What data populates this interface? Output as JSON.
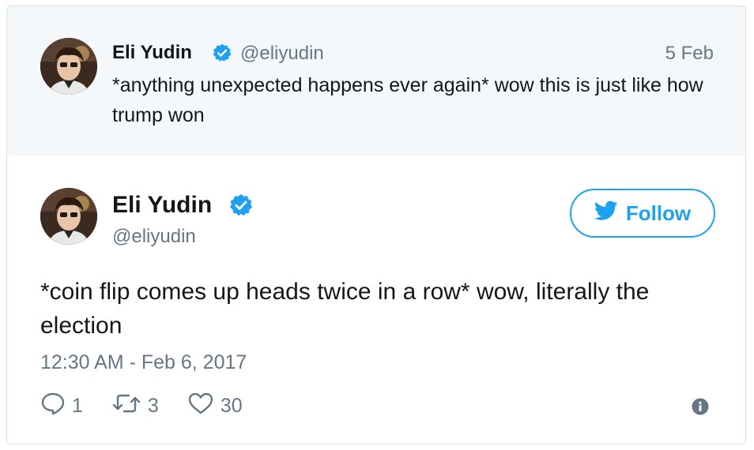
{
  "quoted_tweet": {
    "author_name": "Eli Yudin",
    "author_handle": "@eliyudin",
    "date": "5 Feb",
    "text": "*anything unexpected happens ever again* wow this is just like how trump won",
    "avatar_icon": "profile-photo",
    "verified_icon": "verified-badge-icon"
  },
  "main_tweet": {
    "author_name": "Eli Yudin",
    "author_handle": "@eliyudin",
    "follow_label": "Follow",
    "text": "*coin flip comes up heads twice in a row* wow, literally the election",
    "timestamp": "12:30 AM - Feb 6, 2017",
    "actions": {
      "reply_count": "1",
      "retweet_count": "3",
      "like_count": "30"
    },
    "icons": {
      "reply": "reply-icon",
      "retweet": "retweet-icon",
      "like": "heart-icon",
      "info": "info-icon",
      "bird": "twitter-bird-icon"
    }
  },
  "colors": {
    "accent": "#1da1f2",
    "verified": "#1da1f2",
    "muted_text": "#657786",
    "primary_text": "#14171a",
    "quoted_background": "#f5f8fa",
    "border": "#d9dee3"
  }
}
